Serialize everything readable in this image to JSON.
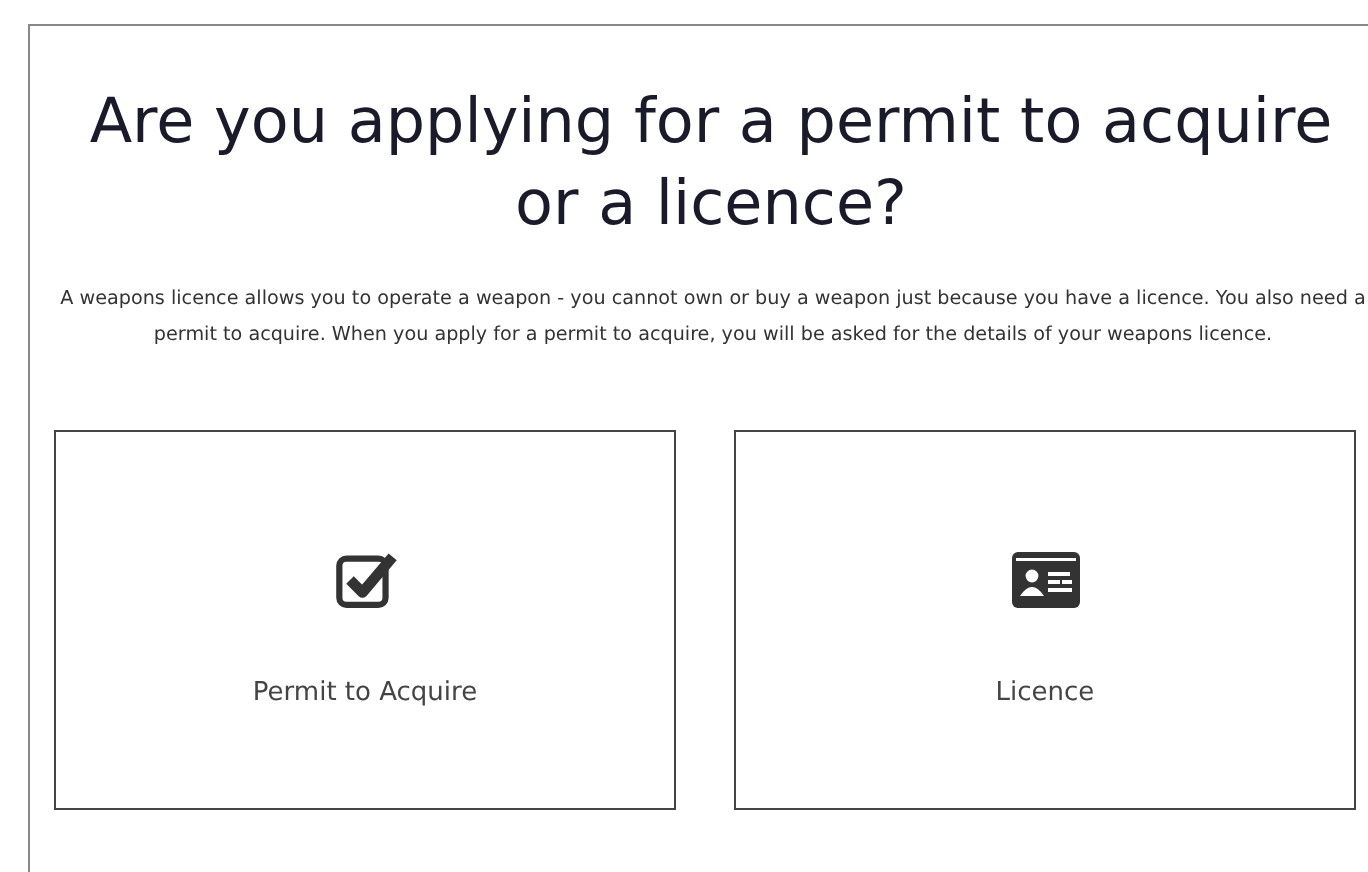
{
  "heading": "Are you applying for a permit to acquire or a licence?",
  "description": "A weapons licence allows you to operate a weapon - you cannot own or buy a weapon just because you have a licence. You also need a permit to acquire. When you apply for a permit to acquire, you will be asked for the details of your weapons licence.",
  "options": [
    {
      "kind": "checkbox",
      "label": "Permit to Acquire"
    },
    {
      "kind": "id-card",
      "label": "Licence"
    }
  ]
}
